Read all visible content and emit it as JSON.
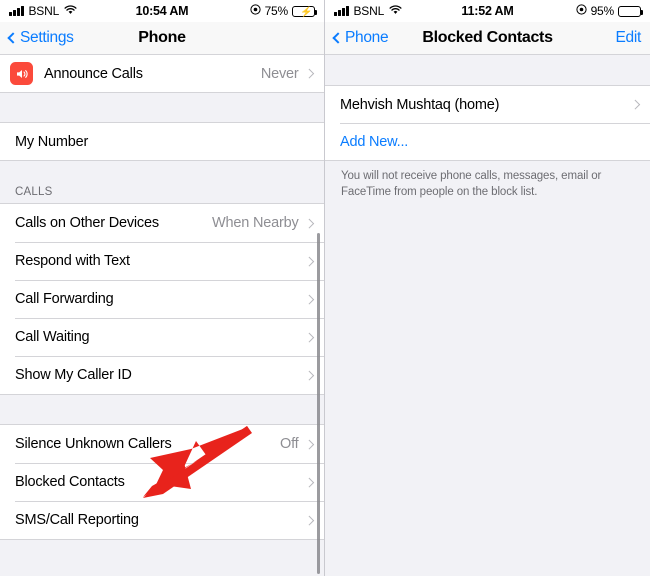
{
  "left_screen": {
    "status_bar": {
      "carrier": "BSNL",
      "time": "10:54 AM",
      "battery_percent": "75%",
      "battery_level": 75,
      "charging": true,
      "signal_icon": "signal-bars-icon",
      "wifi_icon": "wifi-icon",
      "location_icon": "location-services-icon"
    },
    "nav": {
      "back_label": "Settings",
      "title": "Phone"
    },
    "groups": [
      {
        "rows": [
          {
            "label": "Announce Calls",
            "value": "Never",
            "icon": "speaker-announce-icon",
            "chevron": true
          }
        ]
      },
      {
        "rows": [
          {
            "label": "My Number",
            "value": "",
            "chevron": false
          }
        ]
      },
      {
        "header": "CALLS",
        "rows": [
          {
            "label": "Calls on Other Devices",
            "value": "When Nearby",
            "chevron": true
          },
          {
            "label": "Respond with Text",
            "value": "",
            "chevron": true
          },
          {
            "label": "Call Forwarding",
            "value": "",
            "chevron": true
          },
          {
            "label": "Call Waiting",
            "value": "",
            "chevron": true
          },
          {
            "label": "Show My Caller ID",
            "value": "",
            "chevron": true
          }
        ]
      },
      {
        "rows": [
          {
            "label": "Silence Unknown Callers",
            "value": "Off",
            "chevron": true
          },
          {
            "label": "Blocked Contacts",
            "value": "",
            "chevron": true
          },
          {
            "label": "SMS/Call Reporting",
            "value": "",
            "chevron": true
          }
        ]
      }
    ],
    "annotation": {
      "type": "red-arrow",
      "color": "#e8231c",
      "points_to": "Blocked Contacts"
    }
  },
  "right_screen": {
    "status_bar": {
      "carrier": "BSNL",
      "time": "11:52 AM",
      "battery_percent": "95%",
      "battery_level": 95,
      "charging": false,
      "signal_icon": "signal-bars-icon",
      "wifi_icon": "wifi-icon",
      "location_icon": "location-services-icon"
    },
    "nav": {
      "back_label": "Phone",
      "title": "Blocked Contacts",
      "action_label": "Edit"
    },
    "rows": [
      {
        "label": "Mehvish Mushtaq (home)",
        "chevron": true,
        "link": false
      },
      {
        "label": "Add New...",
        "chevron": false,
        "link": true
      }
    ],
    "footer_note": "You will not receive phone calls, messages, email or FaceTime from people on the block list."
  },
  "colors": {
    "accent_blue": "#0a7cff",
    "icon_red": "#fb4a3b",
    "arrow_red": "#e8231c",
    "battery_green": "#4cd763",
    "group_bg": "#ffffff",
    "page_bg": "#f2f2f6",
    "separator": "#d4d4d8",
    "secondary_text": "#8e8e93"
  }
}
